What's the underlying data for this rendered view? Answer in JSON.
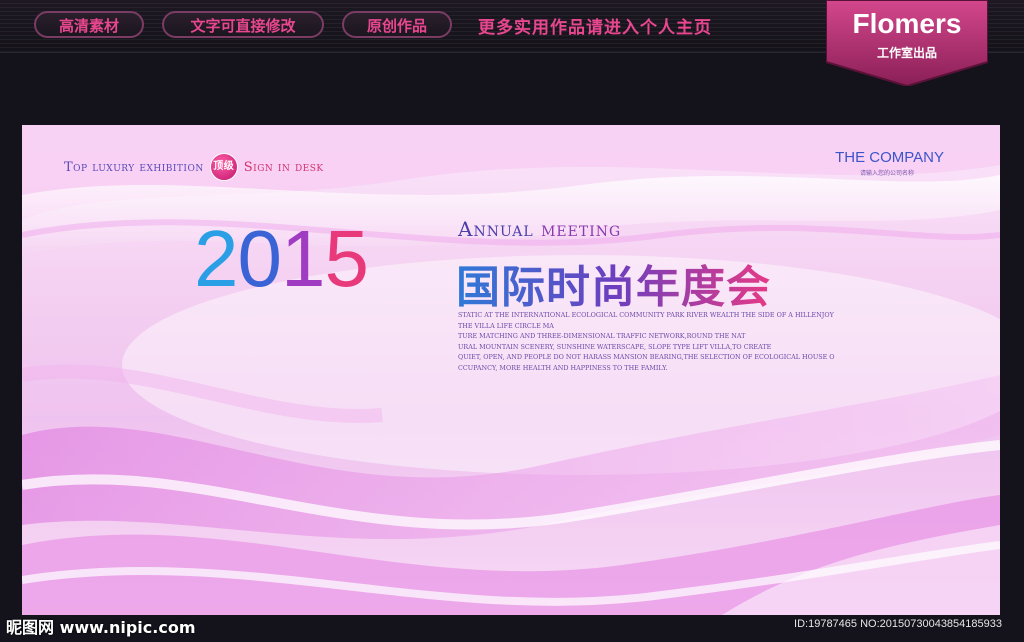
{
  "header": {
    "pills": [
      "高清素材",
      "文字可直接修改",
      "原创作品"
    ],
    "promo": "更多实用作品请进入个人主页",
    "brand": {
      "name": "Flomers",
      "sub": "工作室出品"
    }
  },
  "banner": {
    "top_tag": {
      "part1": "Top luxury exhibition",
      "badge": "顶级",
      "part2": "Sign in desk"
    },
    "company": {
      "name": "THE COMPANY",
      "sub": "请输入您的公司名称"
    },
    "year": [
      "2",
      "0",
      "1",
      "5"
    ],
    "annual": {
      "word1": "Annual",
      "word2": "meeting"
    },
    "cn_title": "国际时尚年度会",
    "description": [
      "STATIC AT THE INTERNATIONAL ECOLOGICAL COMMUNITY PARK RIVER WEALTH THE SIDE OF A HILLENJOY",
      "THE VILLA LIFE CIRCLE MA",
      "TURE MATCHING AND THREE-DIMENSIONAL TRAFFIC NETWORK,ROUND THE NAT",
      "URAL MOUNTAIN SCENERY, SUNSHINE WATERSCAPE, SLOPE TYPE LIFT VILLA,TO CREATE",
      "QUIET, OPEN, AND PEOPLE DO NOT HARASS MANSION BEARING,THE SELECTION OF ECOLOGICAL HOUSE O",
      "CCUPANCY, MORE HEALTH AND HAPPINESS TO THE FAMILY."
    ]
  },
  "footer": {
    "watermark_left": "昵图网 www.nipic.com",
    "watermark_right": "ID:19787465 NO:20150730043854185933"
  },
  "colors": {
    "accent_pink": "#e8478f",
    "year_gradient": [
      "#2aa6e8",
      "#3a5fd0",
      "#9a3fc0",
      "#e83a7a"
    ]
  }
}
